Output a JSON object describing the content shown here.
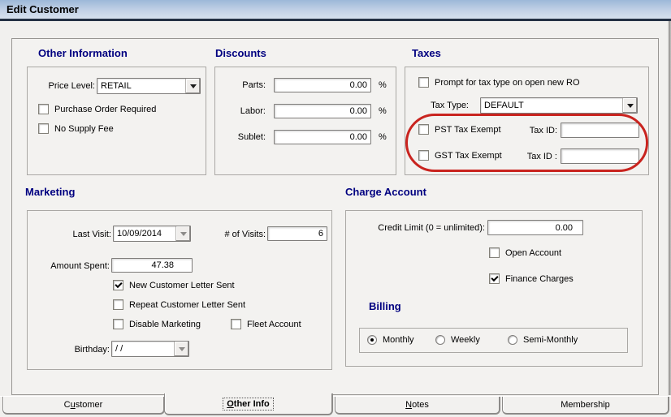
{
  "window": {
    "title": "Edit Customer"
  },
  "colors": {
    "heading_navy": "#000080",
    "annotation_red": "#c9241f",
    "titlebar_top": "#9db8d8",
    "titlebar_bottom": "#d6e0ee"
  },
  "other_information": {
    "heading": "Other Information",
    "price_level": {
      "label": "Price Level:",
      "value": "RETAIL"
    },
    "purchase_order": {
      "label": "Purchase Order Required",
      "checked": false
    },
    "no_supply_fee": {
      "label": "No Supply Fee",
      "checked": false
    }
  },
  "discounts": {
    "heading": "Discounts",
    "rows": [
      {
        "label": "Parts:",
        "value": "0.00",
        "unit": "%"
      },
      {
        "label": "Labor:",
        "value": "0.00",
        "unit": "%"
      },
      {
        "label": "Sublet:",
        "value": "0.00",
        "unit": "%"
      }
    ]
  },
  "taxes": {
    "heading": "Taxes",
    "prompt": {
      "label": "Prompt for tax type on open new RO",
      "checked": false
    },
    "tax_type": {
      "label": "Tax Type:",
      "value": "DEFAULT"
    },
    "pst": {
      "label": "PST Tax Exempt",
      "checked": false,
      "tax_id_label": "Tax ID:",
      "tax_id_value": ""
    },
    "gst": {
      "label": "GST Tax Exempt",
      "checked": false,
      "tax_id_label": "Tax ID :",
      "tax_id_value": ""
    }
  },
  "marketing": {
    "heading": "Marketing",
    "last_visit": {
      "label": "Last Visit:",
      "value": "10/09/2014"
    },
    "visits": {
      "label": "# of Visits:",
      "value": "6"
    },
    "amount_spent": {
      "label": "Amount Spent:",
      "value": "47.38"
    },
    "new_customer_letter": {
      "label": "New Customer Letter Sent",
      "checked": true
    },
    "repeat_customer_letter": {
      "label": "Repeat Customer Letter Sent",
      "checked": false
    },
    "disable_marketing": {
      "label": "Disable Marketing",
      "checked": false
    },
    "fleet_account": {
      "label": "Fleet Account",
      "checked": false
    },
    "birthday": {
      "label": "Birthday:",
      "value": "/ /"
    }
  },
  "charge_account": {
    "heading": "Charge Account",
    "credit_limit": {
      "label": "Credit Limit (0 = unlimited):",
      "value": "0.00"
    },
    "open_account": {
      "label": "Open Account",
      "checked": false
    },
    "finance_charges": {
      "label": "Finance Charges",
      "checked": true
    },
    "billing": {
      "heading": "Billing",
      "options": [
        {
          "label": "Monthly",
          "selected": true
        },
        {
          "label": "Weekly",
          "selected": false
        },
        {
          "label": "Semi-Monthly",
          "selected": false
        }
      ]
    }
  },
  "tabs": [
    {
      "pre": "C",
      "key": "u",
      "post": "stomer",
      "active": false
    },
    {
      "pre": "",
      "key": "O",
      "post": "ther Info",
      "active": true
    },
    {
      "pre": "",
      "key": "N",
      "post": "otes",
      "active": false
    },
    {
      "pre": "Membership",
      "key": "",
      "post": "",
      "active": false
    }
  ]
}
